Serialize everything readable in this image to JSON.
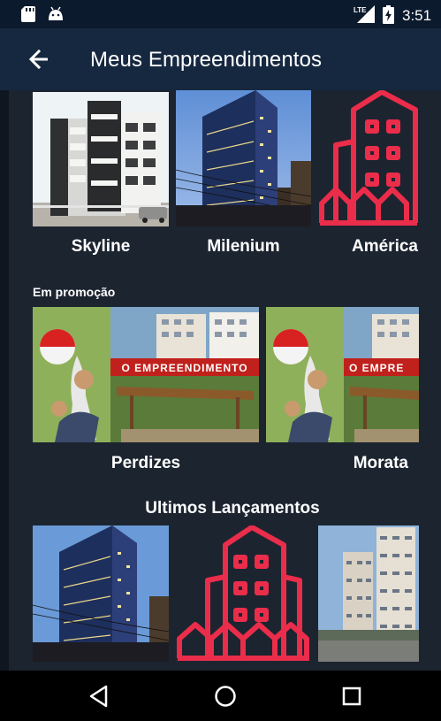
{
  "status_bar": {
    "time": "3:51",
    "network": "LTE",
    "icons": [
      "sd-card-icon",
      "android-icon",
      "signal-icon",
      "battery-charging-icon"
    ]
  },
  "app_bar": {
    "back_icon": "arrow-left-icon",
    "title": "Meus Empreendimentos"
  },
  "featured": {
    "items": [
      {
        "name": "Skyline",
        "image": "white-residential-building-photo"
      },
      {
        "name": "Milenium",
        "image": "glass-tower-photo"
      },
      {
        "name": "América",
        "image": "building-placeholder-icon"
      }
    ]
  },
  "promo": {
    "label": "Em promoção",
    "items": [
      {
        "name": "Perdizes",
        "banner_text": "O EMPREENDIMENTO"
      },
      {
        "name": "Morata",
        "banner_text": "O EMPRE"
      }
    ]
  },
  "latest": {
    "title": "Ultimos Lançamentos",
    "items": [
      {
        "image": "glass-tower-photo"
      },
      {
        "image": "building-placeholder-icon"
      },
      {
        "image": "residential-towers-photo"
      }
    ]
  },
  "nav_bar": {
    "buttons": [
      "back-triangle-icon",
      "home-circle-icon",
      "recents-square-icon"
    ]
  },
  "colors": {
    "app_bar": "#162840",
    "status_bar": "#0c1a2d",
    "content_bg": "#1c2430",
    "placeholder_red": "#ea2d4a",
    "banner_red": "#c0211c"
  }
}
